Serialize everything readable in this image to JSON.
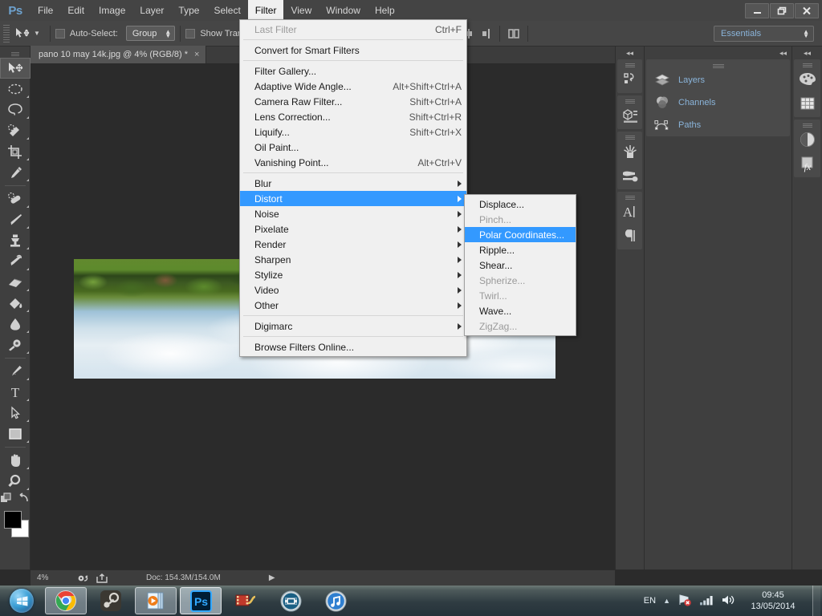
{
  "app": {
    "logo": "Ps",
    "menus": [
      "File",
      "Edit",
      "Image",
      "Layer",
      "Type",
      "Select",
      "Filter",
      "View",
      "Window",
      "Help"
    ],
    "active_menu": "Filter",
    "window_controls": [
      "minimize",
      "restore",
      "close"
    ]
  },
  "options_bar": {
    "tool_icon": "move-tool-icon",
    "auto_select_label": "Auto-Select:",
    "auto_select_value": "Group",
    "show_transform_label": "Show Tran",
    "workspace": "Essentials",
    "align_icons": [
      "align-top-edges-icon",
      "align-vertical-centers-icon",
      "align-bottom-edges-icon",
      "distribute-left-icon",
      "distribute-center-icon",
      "distribute-right-icon",
      "align-panel-icon"
    ]
  },
  "document": {
    "tab_title": "pano 10 may 14k.jpg @ 4% (RGB/8) *",
    "close_glyph": "×"
  },
  "toolbar": {
    "tools": [
      {
        "name": "move-tool",
        "icon": "move-tool-icon",
        "selected": true
      },
      {
        "name": "marquee-tool",
        "icon": "elliptical-marquee-icon",
        "selected": false
      },
      {
        "name": "lasso-tool",
        "icon": "lasso-icon",
        "selected": false
      },
      {
        "name": "quick-selection-tool",
        "icon": "quick-selection-icon",
        "selected": false
      },
      {
        "name": "crop-tool",
        "icon": "crop-icon",
        "selected": false
      },
      {
        "name": "eyedropper-tool",
        "icon": "eyedropper-icon",
        "selected": false
      },
      {
        "name": "healing-brush-tool",
        "icon": "spot-healing-icon",
        "selected": false
      },
      {
        "name": "brush-tool",
        "icon": "brush-icon",
        "selected": false
      },
      {
        "name": "clone-stamp-tool",
        "icon": "clone-stamp-icon",
        "selected": false
      },
      {
        "name": "history-brush-tool",
        "icon": "history-brush-icon",
        "selected": false
      },
      {
        "name": "eraser-tool",
        "icon": "eraser-icon",
        "selected": false
      },
      {
        "name": "gradient-tool",
        "icon": "gradient-bucket-icon",
        "selected": false
      },
      {
        "name": "blur-tool",
        "icon": "blur-drop-icon",
        "selected": false
      },
      {
        "name": "dodge-tool",
        "icon": "dodge-icon",
        "selected": false
      },
      {
        "name": "pen-tool",
        "icon": "pen-icon",
        "selected": false
      },
      {
        "name": "type-tool",
        "icon": "type-tool-icon",
        "selected": false
      },
      {
        "name": "path-selection-tool",
        "icon": "path-selection-icon",
        "selected": false
      },
      {
        "name": "rectangle-tool",
        "icon": "rectangle-shape-icon",
        "selected": false
      },
      {
        "name": "hand-tool",
        "icon": "hand-icon",
        "selected": false
      },
      {
        "name": "zoom-tool",
        "icon": "zoom-magnifier-icon",
        "selected": false
      }
    ],
    "foreground_color": "#000000",
    "background_color": "#ffffff"
  },
  "filter_menu": {
    "groups": [
      [
        {
          "label": "Last Filter",
          "accel": "Ctrl+F",
          "disabled": true,
          "submenu": false
        }
      ],
      [
        {
          "label": "Convert for Smart Filters",
          "accel": "",
          "disabled": false,
          "submenu": false
        }
      ],
      [
        {
          "label": "Filter Gallery...",
          "accel": "",
          "disabled": false,
          "submenu": false
        },
        {
          "label": "Adaptive Wide Angle...",
          "accel": "Alt+Shift+Ctrl+A",
          "disabled": false,
          "submenu": false
        },
        {
          "label": "Camera Raw Filter...",
          "accel": "Shift+Ctrl+A",
          "disabled": false,
          "submenu": false
        },
        {
          "label": "Lens Correction...",
          "accel": "Shift+Ctrl+R",
          "disabled": false,
          "submenu": false
        },
        {
          "label": "Liquify...",
          "accel": "Shift+Ctrl+X",
          "disabled": false,
          "submenu": false
        },
        {
          "label": "Oil Paint...",
          "accel": "",
          "disabled": false,
          "submenu": false
        },
        {
          "label": "Vanishing Point...",
          "accel": "Alt+Ctrl+V",
          "disabled": false,
          "submenu": false
        }
      ],
      [
        {
          "label": "Blur",
          "accel": "",
          "disabled": false,
          "submenu": true
        },
        {
          "label": "Distort",
          "accel": "",
          "disabled": false,
          "submenu": true,
          "highlighted": true
        },
        {
          "label": "Noise",
          "accel": "",
          "disabled": false,
          "submenu": true
        },
        {
          "label": "Pixelate",
          "accel": "",
          "disabled": false,
          "submenu": true
        },
        {
          "label": "Render",
          "accel": "",
          "disabled": false,
          "submenu": true
        },
        {
          "label": "Sharpen",
          "accel": "",
          "disabled": false,
          "submenu": true
        },
        {
          "label": "Stylize",
          "accel": "",
          "disabled": false,
          "submenu": true
        },
        {
          "label": "Video",
          "accel": "",
          "disabled": false,
          "submenu": true
        },
        {
          "label": "Other",
          "accel": "",
          "disabled": false,
          "submenu": true
        }
      ],
      [
        {
          "label": "Digimarc",
          "accel": "",
          "disabled": false,
          "submenu": true
        }
      ],
      [
        {
          "label": "Browse Filters Online...",
          "accel": "",
          "disabled": false,
          "submenu": false
        }
      ]
    ]
  },
  "distort_submenu": {
    "items": [
      {
        "label": "Displace...",
        "disabled": false,
        "highlighted": false
      },
      {
        "label": "Pinch...",
        "disabled": true,
        "highlighted": false
      },
      {
        "label": "Polar Coordinates...",
        "disabled": false,
        "highlighted": true
      },
      {
        "label": "Ripple...",
        "disabled": false,
        "highlighted": false
      },
      {
        "label": "Shear...",
        "disabled": false,
        "highlighted": false
      },
      {
        "label": "Spherize...",
        "disabled": true,
        "highlighted": false
      },
      {
        "label": "Twirl...",
        "disabled": true,
        "highlighted": false
      },
      {
        "label": "Wave...",
        "disabled": false,
        "highlighted": false
      },
      {
        "label": "ZigZag...",
        "disabled": true,
        "highlighted": false
      }
    ]
  },
  "status_bar": {
    "zoom": "4%",
    "doc_info": "Doc: 154.3M/154.0M",
    "icons": [
      "settings-icon",
      "share-icon",
      "expand-arrow-icon"
    ]
  },
  "panels": {
    "collapse_glyph": "◂◂",
    "rows": [
      {
        "label": "Layers",
        "icon": "layers-icon"
      },
      {
        "label": "Channels",
        "icon": "channels-icon"
      },
      {
        "label": "Paths",
        "icon": "paths-icon"
      }
    ],
    "icon_dock_left": [
      {
        "icon": "history-icon"
      },
      {
        "icon": "3d-icon"
      },
      {
        "icon": "brush-panel-icon"
      },
      {
        "icon": "brush-presets-icon"
      },
      {
        "icon": "character-icon"
      },
      {
        "icon": "paragraph-icon"
      }
    ],
    "icon_dock_right": [
      {
        "icon": "color-swatches-icon"
      },
      {
        "icon": "swatches-grid-icon"
      },
      {
        "icon": "adjustments-icon"
      },
      {
        "icon": "styles-fx-icon"
      }
    ]
  },
  "taskbar": {
    "start_label": "start-orb",
    "items": [
      {
        "name": "chrome",
        "state": "open"
      },
      {
        "name": "steam",
        "state": "idle"
      },
      {
        "name": "media-player",
        "state": "open"
      },
      {
        "name": "photoshop",
        "state": "active"
      },
      {
        "name": "video-editor",
        "state": "idle"
      },
      {
        "name": "movie-maker",
        "state": "idle"
      },
      {
        "name": "itunes",
        "state": "idle"
      }
    ],
    "tray": {
      "language": "EN",
      "network_status": "network-error-icon",
      "signal": "signal-bars-icon",
      "volume": "volume-icon",
      "time": "09:45",
      "date": "13/05/2014"
    }
  },
  "colors": {
    "menu_highlight": "#3399ff",
    "panel_text": "#8ab4da",
    "chrome_bg": "#3f3f3f",
    "menubar_bg": "#444444"
  }
}
